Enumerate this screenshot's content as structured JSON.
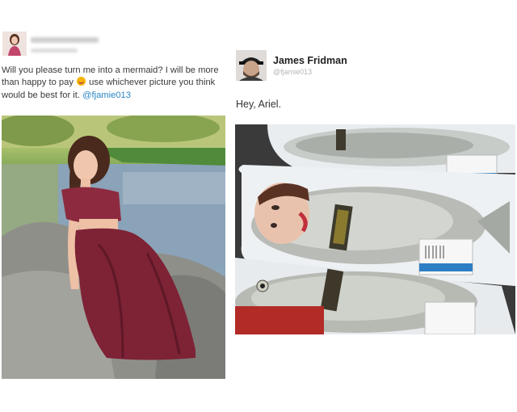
{
  "left_tweet": {
    "avatar_icon": "woman-avatar-icon",
    "text_before_emoji": "Will you please turn me into a mermaid? I will be more than happy to pay",
    "emoji": "smiling-face-emoji",
    "text_after_emoji": "use whichever picture you think would be best for it.",
    "mention": "@fjamie013",
    "photo": "woman-in-red-lace-outfit-sitting-on-rock-by-water"
  },
  "right_tweet": {
    "avatar_icon": "man-with-cap-avatar-icon",
    "author_name": "James Fridman",
    "author_handle": "@fjamie013",
    "reply_text": "Hey, Ariel.",
    "photo": "fish-in-trays-with-face-edited-onto-fish",
    "price_label_lines": [
      "Ⅲ Ⅲ Ⅲ",
      "|||||||||||"
    ]
  },
  "colors": {
    "link": "#2b86c5",
    "name": "#1f1f1f",
    "handle": "#b5b5b5",
    "body_text": "#3a3a3a"
  }
}
